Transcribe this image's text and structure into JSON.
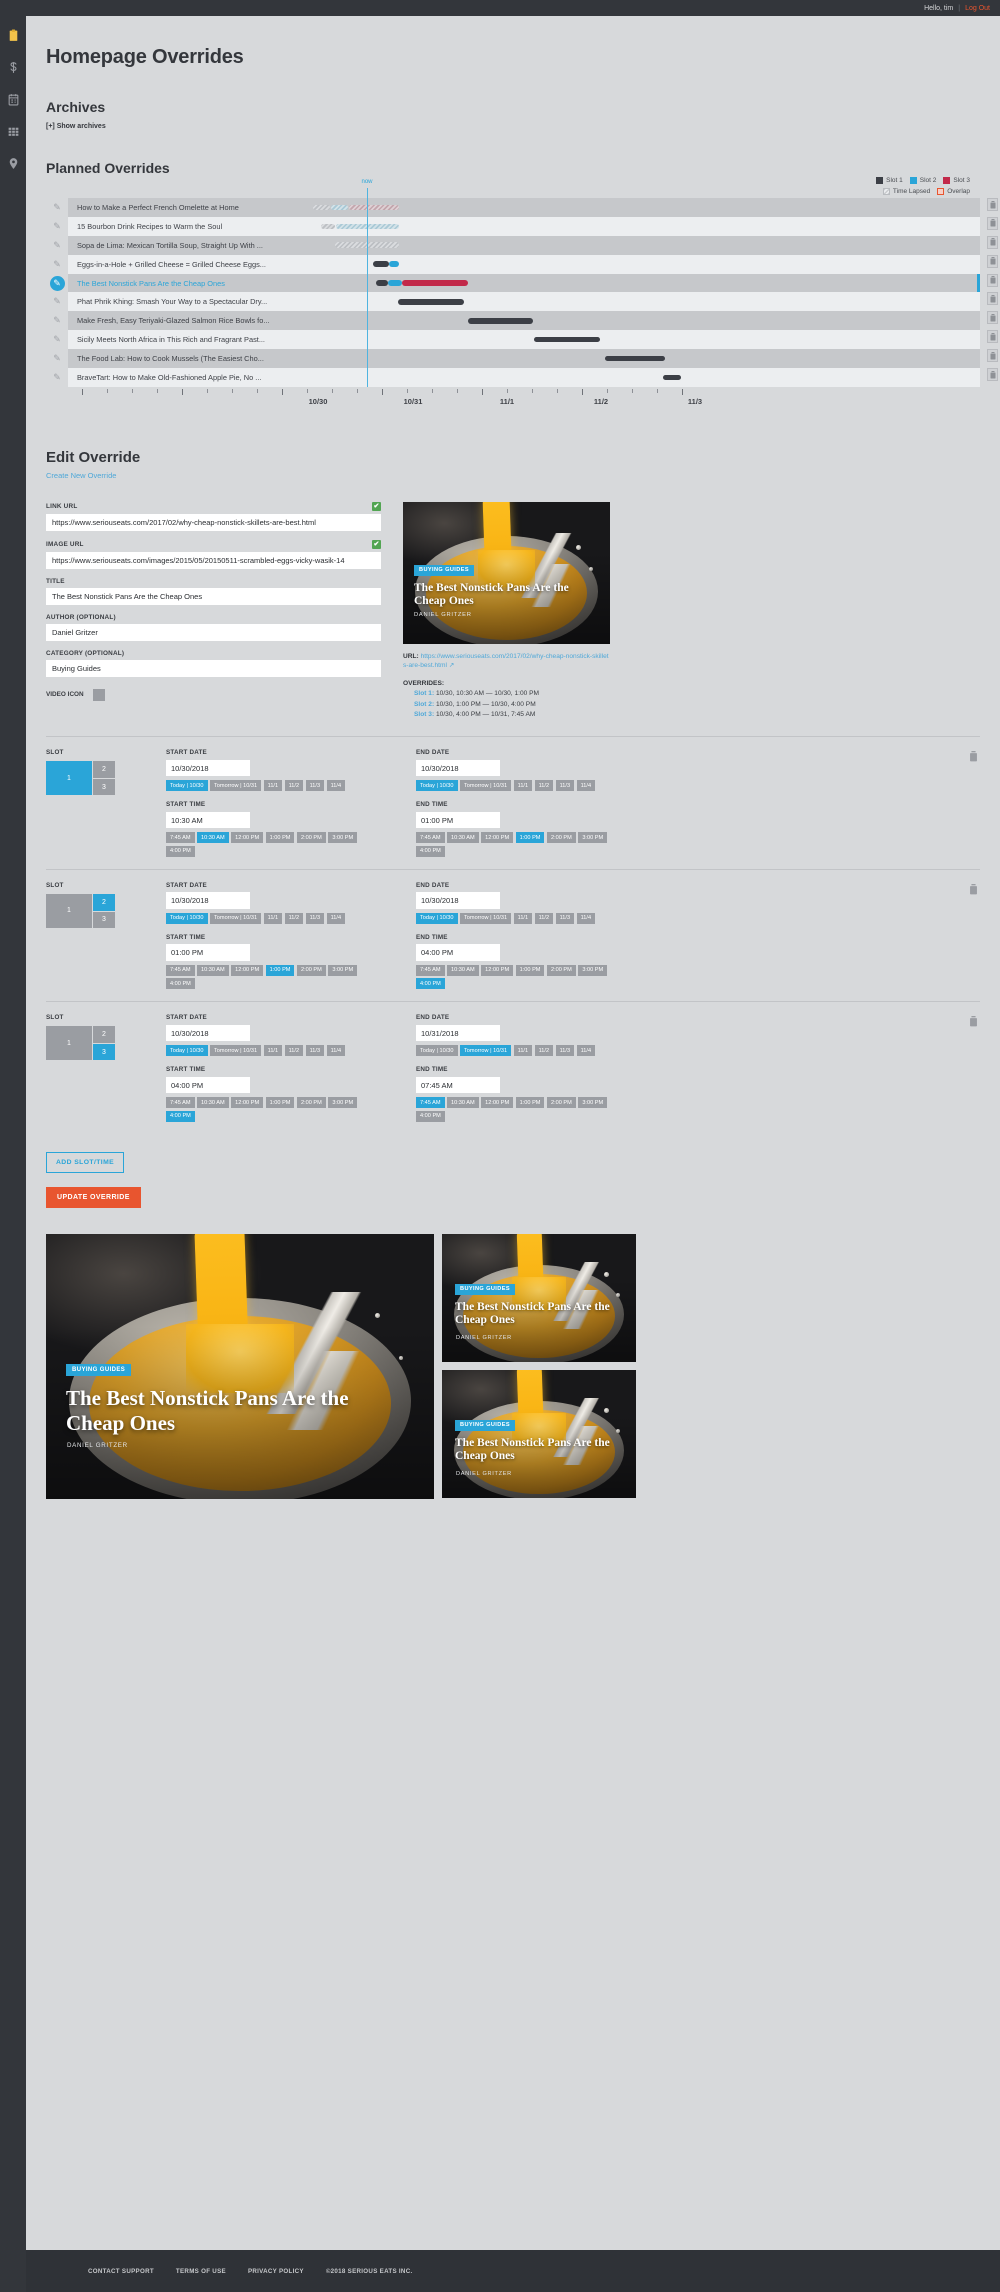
{
  "topbar": {
    "greeting": "Hello, tim",
    "separator": "|",
    "logout": "Log Out"
  },
  "rail": [
    {
      "name": "clipboard-icon",
      "glyph": "clipboard"
    },
    {
      "name": "dollar-icon",
      "glyph": "dollar"
    },
    {
      "name": "calendar-icon",
      "glyph": "calendar"
    },
    {
      "name": "grid-icon",
      "glyph": "grid"
    },
    {
      "name": "pin-icon",
      "glyph": "pin"
    }
  ],
  "page": {
    "title": "Homepage Overrides",
    "archives_heading": "Archives",
    "show_archives": "[+] Show archives",
    "planned_heading": "Planned Overrides"
  },
  "timeline": {
    "now_label": "now",
    "legend": [
      {
        "key": "slot1",
        "label": "Slot 1",
        "color": "#3c3f46"
      },
      {
        "key": "slot2",
        "label": "Slot 2",
        "color": "#2aa5d8"
      },
      {
        "key": "slot3",
        "label": "Slot 3",
        "color": "#c2294a"
      },
      {
        "key": "lapsed",
        "label": "Time Lapsed",
        "color": "#d0d2d5"
      },
      {
        "key": "overlap",
        "label": "Overlap",
        "color": "#e8552f"
      }
    ],
    "axis_labels": [
      "10/30",
      "10/31",
      "11/1",
      "11/2",
      "11/3"
    ],
    "rows": [
      {
        "title": "How to Make a Perfect French Omelette at Home",
        "selected": false
      },
      {
        "title": "15 Bourbon Drink Recipes to Warm the Soul",
        "selected": false
      },
      {
        "title": "Sopa de Lima: Mexican Tortilla Soup, Straight Up With ...",
        "selected": false
      },
      {
        "title": "Eggs-in-a-Hole + Grilled Cheese = Grilled Cheese Eggs...",
        "selected": false
      },
      {
        "title": "The Best Nonstick Pans Are the Cheap Ones",
        "selected": true
      },
      {
        "title": "Phat Phrik Khing: Smash Your Way to a Spectacular Dry...",
        "selected": false
      },
      {
        "title": "Make Fresh, Easy Teriyaki-Glazed Salmon Rice Bowls fo...",
        "selected": false
      },
      {
        "title": "Sicily Meets North Africa in This Rich and Fragrant Past...",
        "selected": false
      },
      {
        "title": "The Food Lab: How to Cook Mussels (The Easiest Cho...",
        "selected": false
      },
      {
        "title": "BraveTart: How to Make Old-Fashioned Apple Pie, No ...",
        "selected": false
      }
    ]
  },
  "edit": {
    "heading": "Edit Override",
    "create_link": "Create New Override",
    "fields": {
      "link_url_label": "LINK URL",
      "link_url_value": "https://www.seriouseats.com/2017/02/why-cheap-nonstick-skillets-are-best.html",
      "image_url_label": "IMAGE URL",
      "image_url_value": "https://www.seriouseats.com/images/2015/05/20150511-scrambled-eggs-vicky-wasik-14",
      "title_label": "TITLE",
      "title_value": "The Best Nonstick Pans Are the Cheap Ones",
      "author_label": "AUTHOR (OPTIONAL)",
      "author_value": "Daniel Gritzer",
      "category_label": "CATEGORY (OPTIONAL)",
      "category_value": "Buying Guides",
      "video_icon_label": "VIDEO ICON",
      "valid_check": "✔"
    }
  },
  "preview": {
    "badge": "BUYING GUIDES",
    "title": "The Best Nonstick Pans Are the Cheap Ones",
    "author": "DANIEL GRITZER",
    "url_label": "URL:",
    "url_value": "https://www.seriouseats.com/2017/02/why-cheap-nonstick-skillets-are-best.html",
    "overrides_label": "OVERRIDES:",
    "overrides": [
      {
        "slot": "Slot 1:",
        "range": "10/30, 10:30 AM  —  10/30, 1:00 PM"
      },
      {
        "slot": "Slot 2:",
        "range": "10/30, 1:00 PM  —  10/30, 4:00 PM"
      },
      {
        "slot": "Slot 3:",
        "range": "10/30, 4:00 PM  —  10/31, 7:45 AM"
      }
    ]
  },
  "slot_editor": {
    "labels": {
      "slot": "SLOT",
      "start_date": "START DATE",
      "end_date": "END DATE",
      "start_time": "START TIME",
      "end_time": "END TIME"
    },
    "slot_numbers": [
      "1",
      "2",
      "3"
    ],
    "date_chips": [
      "Today | 10/30",
      "Tomorrow | 10/31",
      "11/1",
      "11/2",
      "11/3",
      "11/4"
    ],
    "time_chips": [
      "7:45 AM",
      "10:30 AM",
      "12:00 PM",
      "1:00 PM",
      "2:00 PM",
      "3:00 PM",
      "4:00 PM"
    ],
    "rows": [
      {
        "active_slot": 1,
        "start_date": "10/30/2018",
        "start_date_chip": "Today | 10/30",
        "start_time": "10:30 AM",
        "start_time_chip": "10:30 AM",
        "end_date": "10/30/2018",
        "end_date_chip": "Today | 10/30",
        "end_time": "01:00 PM",
        "end_time_chip": "1:00 PM"
      },
      {
        "active_slot": 2,
        "start_date": "10/30/2018",
        "start_date_chip": "Today | 10/30",
        "start_time": "01:00 PM",
        "start_time_chip": "1:00 PM",
        "end_date": "10/30/2018",
        "end_date_chip": "Today | 10/30",
        "end_time": "04:00 PM",
        "end_time_chip": "4:00 PM"
      },
      {
        "active_slot": 3,
        "start_date": "10/30/2018",
        "start_date_chip": "Today | 10/30",
        "start_time": "04:00 PM",
        "start_time_chip": "4:00 PM",
        "end_date": "10/31/2018",
        "end_date_chip": "Tomorrow | 10/31",
        "end_time": "07:45 AM",
        "end_time_chip": "7:45 AM"
      }
    ],
    "add_button": "ADD SLOT/TIME",
    "update_button": "UPDATE OVERRIDE"
  },
  "bottom_preview": {
    "big": {
      "badge": "BUYING GUIDES",
      "title": "The Best Nonstick Pans Are the Cheap Ones",
      "author": "DANIEL GRITZER"
    },
    "small": [
      {
        "badge": "BUYING GUIDES",
        "title": "The Best Nonstick Pans Are the Cheap Ones",
        "author": "DANIEL GRITZER"
      },
      {
        "badge": "BUYING GUIDES",
        "title": "The Best Nonstick Pans Are the Cheap Ones",
        "author": "DANIEL GRITZER"
      }
    ]
  },
  "footer": {
    "links": [
      "CONTACT SUPPORT",
      "TERMS OF USE",
      "PRIVACY POLICY"
    ],
    "copyright": "©2018 SERIOUS EATS INC."
  }
}
